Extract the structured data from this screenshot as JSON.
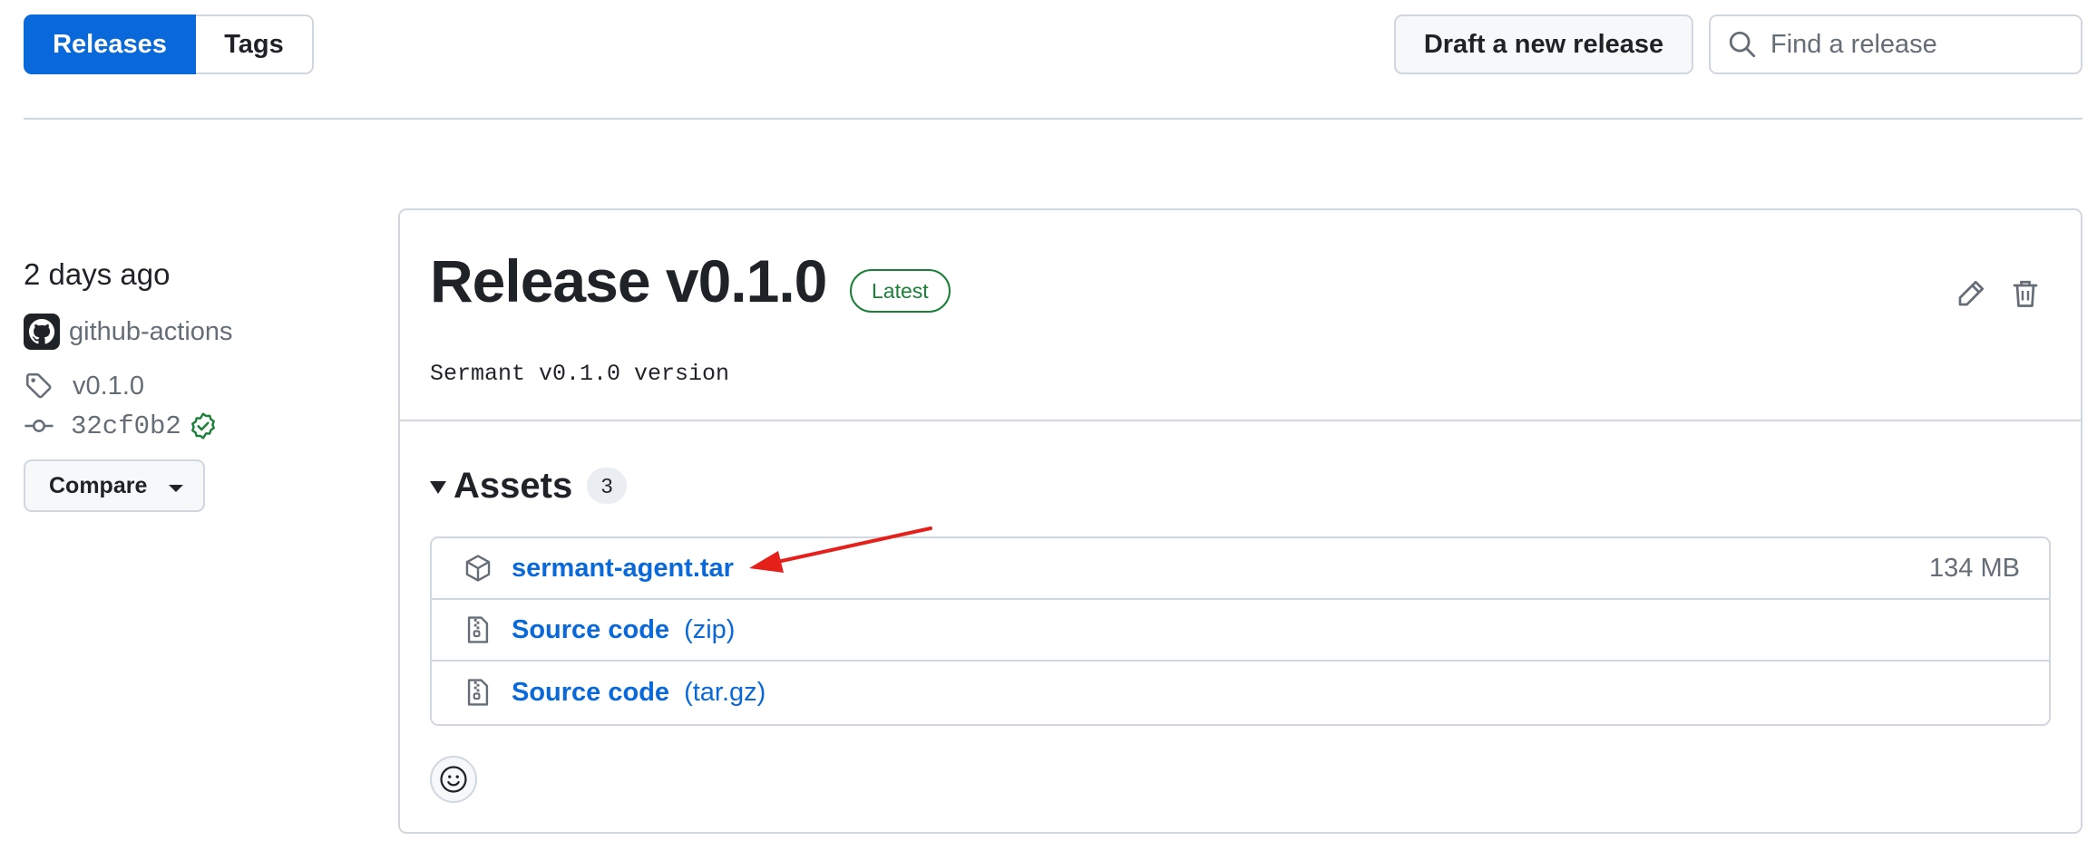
{
  "tabs": {
    "releases": "Releases",
    "tags": "Tags"
  },
  "header": {
    "draft_button": "Draft a new release"
  },
  "search": {
    "placeholder": "Find a release",
    "value": ""
  },
  "meta": {
    "date": "2 days ago",
    "author": "github-actions",
    "tag": "v0.1.0",
    "commit": "32cf0b2",
    "compare_button": "Compare"
  },
  "release": {
    "title": "Release v0.1.0",
    "badge": "Latest",
    "description": "Sermant v0.1.0 version"
  },
  "assets": {
    "label": "Assets",
    "count": "3",
    "items": [
      {
        "name": "sermant-agent.tar",
        "format": "",
        "size": "134 MB",
        "icon": "package-icon"
      },
      {
        "name": "Source code",
        "format": "(zip)",
        "size": "",
        "icon": "file-zip-icon"
      },
      {
        "name": "Source code",
        "format": "(tar.gz)",
        "size": "",
        "icon": "file-zip-icon"
      }
    ]
  },
  "colors": {
    "accent": "#0969da",
    "success": "#1a7f37",
    "annotation": "#e5201b"
  }
}
